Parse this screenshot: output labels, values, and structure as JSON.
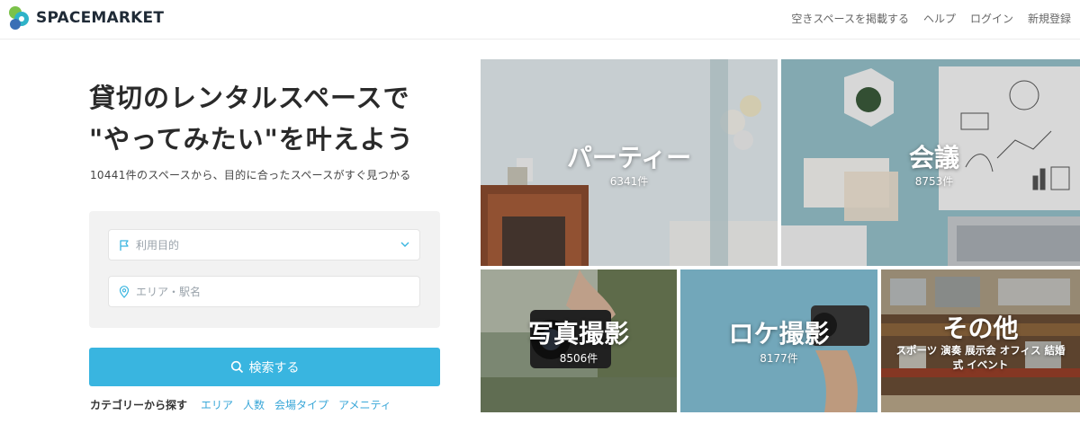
{
  "header": {
    "brand": "SPACEMARKET",
    "nav": [
      "空きスペースを掲載する",
      "ヘルプ",
      "ログイン",
      "新規登録"
    ]
  },
  "hero": {
    "title_line1": "貸切のレンタルスペースで",
    "title_line2": "\"やってみたい\"を叶えよう",
    "subtitle": "10441件のスペースから、目的に合ったスペースがすぐ見つかる"
  },
  "search": {
    "purpose_placeholder": "利用目的",
    "area_placeholder": "エリア・駅名",
    "button_label": "検索する"
  },
  "categories": {
    "label": "カテゴリーから探す",
    "links": [
      "エリア",
      "人数",
      "会場タイプ",
      "アメニティ"
    ]
  },
  "tiles": [
    {
      "title": "パーティー",
      "count": "6341件"
    },
    {
      "title": "会議",
      "count": "8753件"
    },
    {
      "title": "写真撮影",
      "count": "8506件"
    },
    {
      "title": "ロケ撮影",
      "count": "8177件"
    },
    {
      "title": "その他",
      "subtitle": "スポーツ 演奏 展示会 オフィス 結婚式 イベント"
    }
  ],
  "colors": {
    "accent": "#39b5e0",
    "link": "#39a7d8"
  }
}
